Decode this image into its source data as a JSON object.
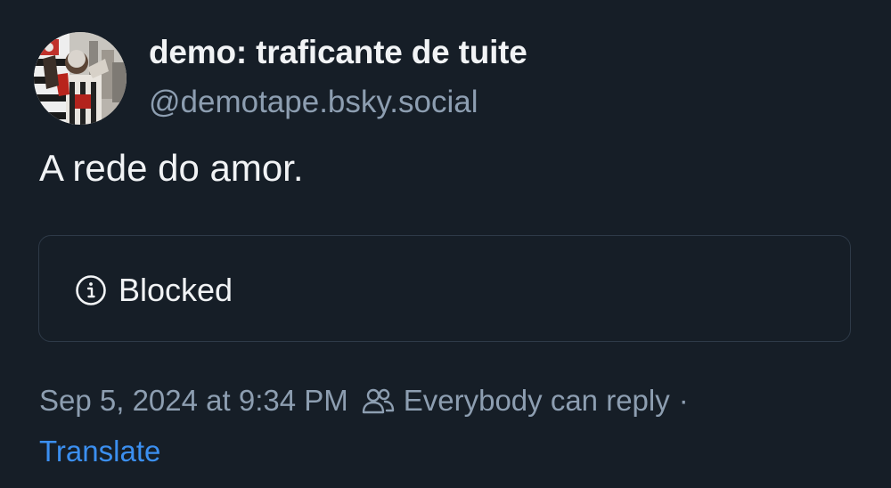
{
  "author": {
    "display_name": "demo: traficante de tuite",
    "handle": "@demotape.bsky.social"
  },
  "post": {
    "text": "A rede do amor.",
    "embed": {
      "status_label": "Blocked",
      "icon": "info-icon"
    },
    "timestamp": "Sep 5, 2024 at 9:34 PM",
    "reply_setting_icon": "people-icon",
    "reply_setting": "Everybody can reply",
    "separator": "·",
    "translate_label": "Translate"
  },
  "colors": {
    "background": "#161e27",
    "text_primary": "#f1f3f5",
    "text_secondary": "#8d9eb1",
    "link": "#3b8ff0",
    "border": "#2e3a48"
  }
}
